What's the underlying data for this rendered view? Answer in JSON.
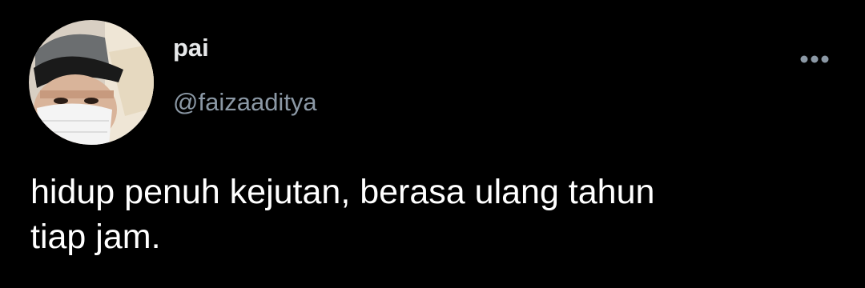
{
  "tweet": {
    "author": {
      "display_name": "pai",
      "handle": "@faizaaditya"
    },
    "text": "hidup penuh kejutan, berasa ulang tahun\ntiap jam.",
    "more_icon": "more-horizontal-icon"
  },
  "colors": {
    "background": "#000000",
    "name": "#e7e9ea",
    "handle": "#8b98a5",
    "text": "#ffffff"
  }
}
